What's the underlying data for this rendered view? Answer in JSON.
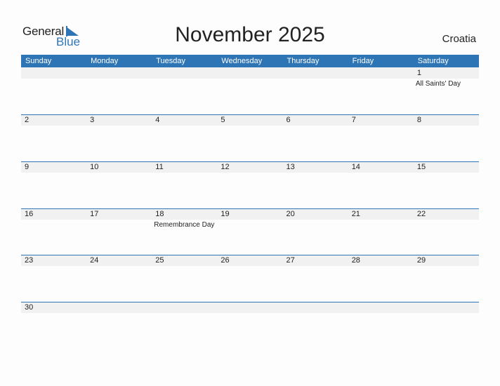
{
  "logo": {
    "general": "General",
    "blue": "Blue"
  },
  "title": "November 2025",
  "country": "Croatia",
  "weekdays": [
    "Sunday",
    "Monday",
    "Tuesday",
    "Wednesday",
    "Thursday",
    "Friday",
    "Saturday"
  ],
  "weeks": [
    [
      {
        "day": ""
      },
      {
        "day": ""
      },
      {
        "day": ""
      },
      {
        "day": ""
      },
      {
        "day": ""
      },
      {
        "day": ""
      },
      {
        "day": "1",
        "holiday": "All Saints' Day"
      }
    ],
    [
      {
        "day": "2"
      },
      {
        "day": "3"
      },
      {
        "day": "4"
      },
      {
        "day": "5"
      },
      {
        "day": "6"
      },
      {
        "day": "7"
      },
      {
        "day": "8"
      }
    ],
    [
      {
        "day": "9"
      },
      {
        "day": "10"
      },
      {
        "day": "11"
      },
      {
        "day": "12"
      },
      {
        "day": "13"
      },
      {
        "day": "14"
      },
      {
        "day": "15"
      }
    ],
    [
      {
        "day": "16"
      },
      {
        "day": "17"
      },
      {
        "day": "18",
        "holiday": "Remembrance Day"
      },
      {
        "day": "19"
      },
      {
        "day": "20"
      },
      {
        "day": "21"
      },
      {
        "day": "22"
      }
    ],
    [
      {
        "day": "23"
      },
      {
        "day": "24"
      },
      {
        "day": "25"
      },
      {
        "day": "26"
      },
      {
        "day": "27"
      },
      {
        "day": "28"
      },
      {
        "day": "29"
      }
    ],
    [
      {
        "day": "30"
      },
      {
        "day": ""
      },
      {
        "day": ""
      },
      {
        "day": ""
      },
      {
        "day": ""
      },
      {
        "day": ""
      },
      {
        "day": ""
      }
    ]
  ],
  "colors": {
    "accent": "#2e75b6",
    "band": "#f1f1f1"
  }
}
